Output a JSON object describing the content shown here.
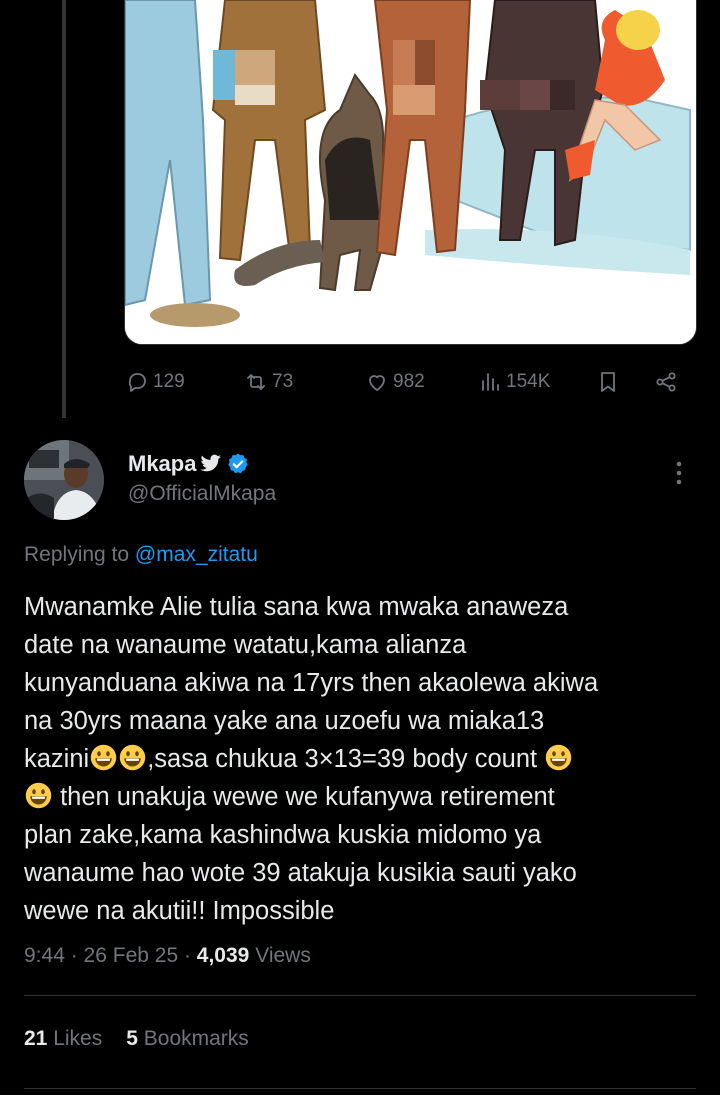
{
  "parent_tweet": {
    "media_icon": "censored-cartoon-illustration",
    "actions": {
      "replies": "129",
      "reposts": "73",
      "likes": "982",
      "views": "154K"
    }
  },
  "reply": {
    "display_name": "Mkapa",
    "name_badges": [
      "bird-icon",
      "verified-badge-icon"
    ],
    "handle": "@OfficialMkapa",
    "replying_prefix": "Replying to",
    "replying_mention": "@max_zitatu",
    "text_lines": [
      "Mwanamke Alie tulia sana kwa mwaka anaweza",
      "date na wanaume watatu,kama alianza",
      "kunyanduana akiwa na 17yrs then akaolewa akiwa",
      "na 30yrs maana yake ana uzoefu wa miaka13",
      "kazini",
      ",sasa chukua 3×13=39 body count ",
      " then unakuja wewe we kufanywa retirement",
      "plan zake,kama kashindwa kuskia midomo ya",
      "wanaume hao wote 39 atakuja kusikia sauti yako",
      "wewe na akutii!! Impossible"
    ],
    "emoji_icon": "grinning-face-emoji",
    "time": "9:44",
    "date": "26 Feb 25",
    "views_count": "4,039",
    "views_label": "Views",
    "likes_count": "21",
    "likes_label": "Likes",
    "bookmarks_count": "5",
    "bookmarks_label": "Bookmarks",
    "colors": {
      "background": "#000000",
      "text": "#e7e9ea",
      "muted": "#71767b",
      "link": "#1d9bf0",
      "divider": "#2f3336"
    }
  }
}
